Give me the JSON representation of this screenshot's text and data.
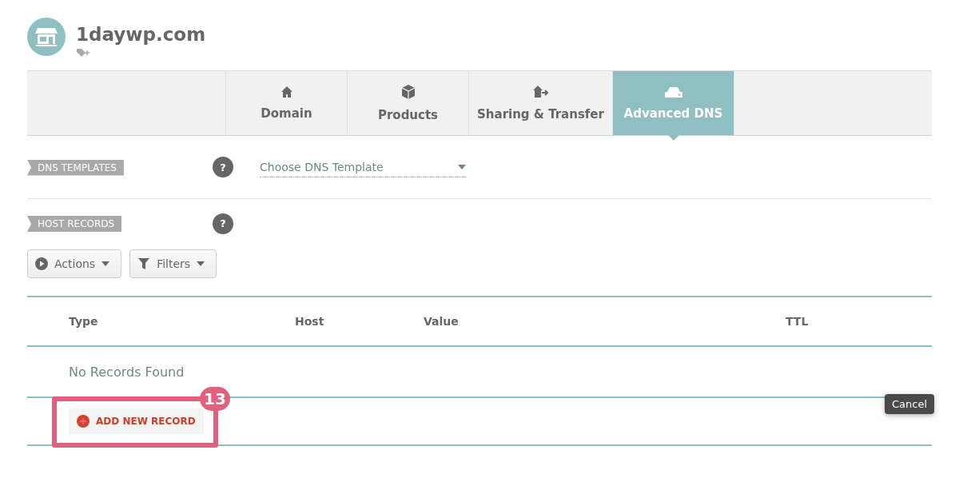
{
  "header": {
    "title": "1daywp.com"
  },
  "tabs": [
    {
      "label": "Domain",
      "kind": "home",
      "selected": false
    },
    {
      "label": "Products",
      "kind": "box",
      "selected": false
    },
    {
      "label": "Sharing & Transfer",
      "kind": "share",
      "selected": false
    },
    {
      "label": "Advanced DNS",
      "kind": "dns",
      "selected": true
    }
  ],
  "dns_templates": {
    "label": "DNS TEMPLATES",
    "help": "?",
    "select": {
      "placeholder": "Choose DNS Template"
    }
  },
  "host_records": {
    "label": "HOST RECORDS",
    "help": "?"
  },
  "toolbar": [
    {
      "label": "Actions",
      "kind": "play"
    },
    {
      "label": "Filters",
      "kind": "filter"
    }
  ],
  "table": {
    "columns": [
      "Type",
      "Host",
      "Value",
      "TTL"
    ],
    "empty_message": "No Records Found"
  },
  "add_button": {
    "label": "ADD NEW RECORD"
  },
  "annotation": {
    "number": "13"
  },
  "tooltip": {
    "text": "Cancel"
  }
}
